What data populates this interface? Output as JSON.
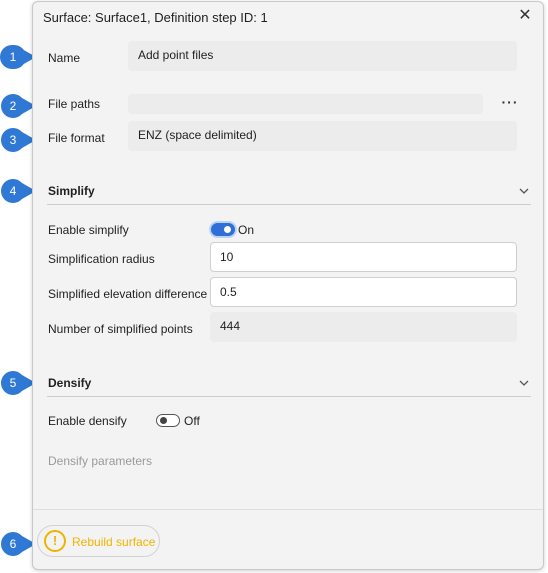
{
  "dialog": {
    "title": "Surface: Surface1, Definition step ID: 1",
    "close_glyph": "✕"
  },
  "fields": {
    "name_label": "Name",
    "name_value": "Add point files",
    "file_paths_label": "File paths",
    "file_paths_value": "",
    "more_glyph": "···",
    "file_format_label": "File format",
    "file_format_value": "ENZ (space delimited)"
  },
  "simplify": {
    "header": "Simplify",
    "enable_label": "Enable simplify",
    "enable_state": "On",
    "radius_label": "Simplification radius",
    "radius_value": "10",
    "elev_label": "Simplified elevation difference",
    "elev_value": "0.5",
    "points_label": "Number of simplified points",
    "points_value": "444"
  },
  "densify": {
    "header": "Densify",
    "enable_label": "Enable densify",
    "enable_state": "Off",
    "params_label": "Densify parameters"
  },
  "footer": {
    "rebuild_label": "Rebuild surface",
    "warn_glyph": "!"
  },
  "callouts": [
    "1",
    "2",
    "3",
    "4",
    "5",
    "6"
  ],
  "colors": {
    "callout": "#2f78d4",
    "toggle_on": "#2f6fd6",
    "warning": "#f0b400"
  },
  "icons": {
    "close": "close-icon",
    "more": "more-options-icon",
    "chevron": "chevron-down-icon",
    "warning": "warning-icon"
  }
}
